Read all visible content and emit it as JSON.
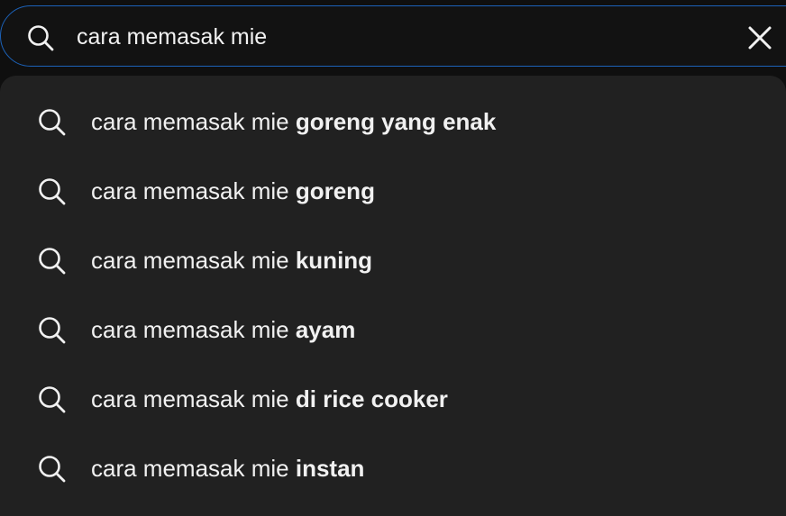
{
  "search": {
    "query": "cara memasak mie",
    "clear_icon": "close-icon",
    "search_icon": "search-icon",
    "accent_color": "#1c62b9"
  },
  "suggestions": [
    {
      "prefix": "cara memasak mie ",
      "completion": "goreng yang enak",
      "icon": "search-icon"
    },
    {
      "prefix": "cara memasak mie ",
      "completion": "goreng",
      "icon": "search-icon"
    },
    {
      "prefix": "cara memasak mie ",
      "completion": "kuning",
      "icon": "search-icon"
    },
    {
      "prefix": "cara memasak mie ",
      "completion": "ayam",
      "icon": "search-icon"
    },
    {
      "prefix": "cara memasak mie ",
      "completion": "di rice cooker",
      "icon": "search-icon"
    },
    {
      "prefix": "cara memasak mie ",
      "completion": "instan",
      "icon": "search-icon"
    }
  ]
}
